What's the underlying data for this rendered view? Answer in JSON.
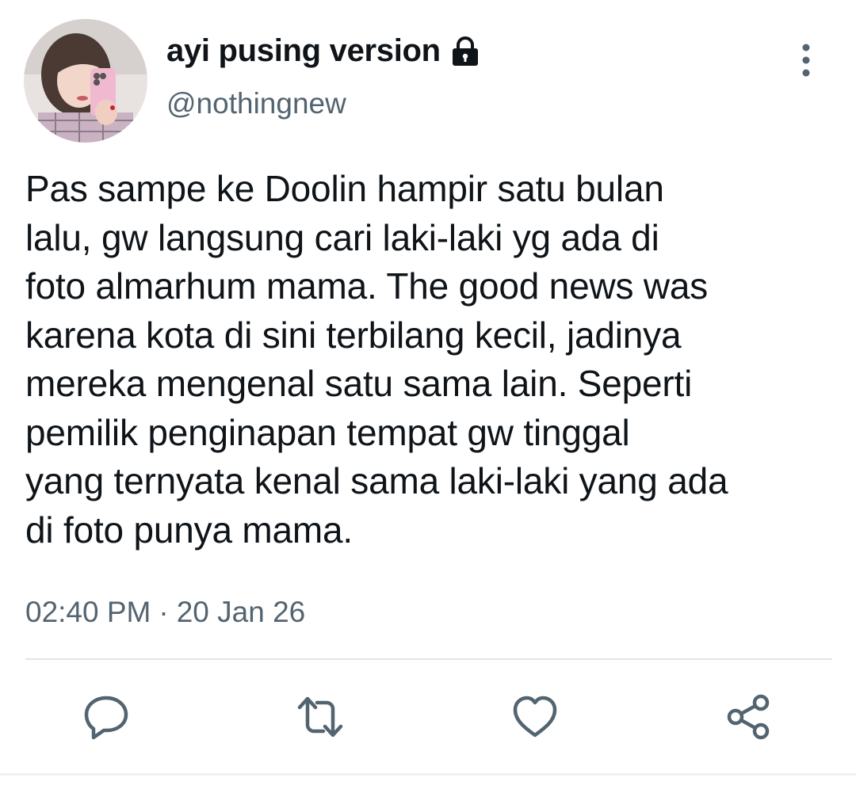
{
  "user": {
    "display_name": "ayi pusing version",
    "handle": "@nothingnew",
    "protected_icon": "lock-icon",
    "avatar": "profile-photo"
  },
  "tweet": {
    "lines": [
      "Pas sampe ke Doolin hampir satu bulan",
      "lalu, gw langsung cari laki-laki yg ada di",
      "foto almarhum mama. The good news was",
      "karena kota di sini terbilang kecil, jadinya",
      "mereka mengenal satu sama lain. Seperti",
      "pemilik penginapan tempat gw tinggal",
      "yang ternyata kenal sama laki-laki yang ada",
      "di foto punya mama."
    ],
    "time": "02:40 PM",
    "separator": "·",
    "date": "20 Jan 26"
  },
  "actions": [
    {
      "icon": "reply-icon"
    },
    {
      "icon": "retweet-icon"
    },
    {
      "icon": "like-icon"
    },
    {
      "icon": "share-icon"
    }
  ],
  "menu": {
    "icon": "more-vertical-icon"
  },
  "colors": {
    "text": "#0f1419",
    "secondary": "#536471",
    "divider": "#e1e6ea",
    "icon": "#536471"
  }
}
